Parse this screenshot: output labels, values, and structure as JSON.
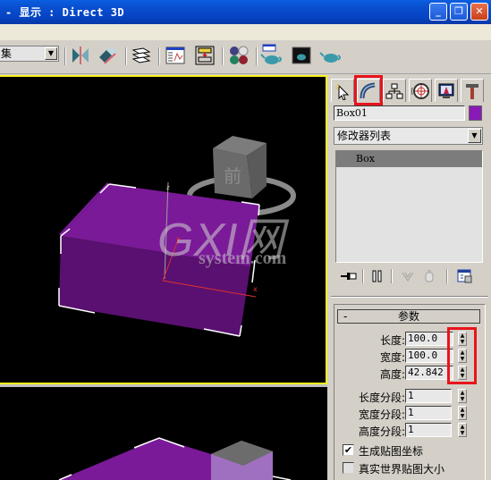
{
  "window": {
    "title": "- 显示 : Direct 3D",
    "controls": {
      "minimize": "_",
      "restore": "❐",
      "close": "✕"
    }
  },
  "toolbar": {
    "selection_set_value": "集",
    "buttons": [
      {
        "name": "mirror",
        "icon": "mirror-icon"
      },
      {
        "name": "align",
        "icon": "align-icon"
      },
      {
        "name": "layer-manager",
        "icon": "layers-icon"
      },
      {
        "name": "track-view",
        "icon": "curve-editor-icon"
      },
      {
        "name": "schematic-view",
        "icon": "schematic-icon"
      },
      {
        "name": "material-editor",
        "icon": "material-spheres-icon"
      },
      {
        "name": "render-scene",
        "icon": "render-setup-teapot-icon"
      },
      {
        "name": "rendered-frame",
        "icon": "rendered-frame-icon"
      },
      {
        "name": "quick-render",
        "icon": "quick-render-teapot-icon"
      }
    ]
  },
  "viewport": {
    "active": "top",
    "object_color": "#7a1a98",
    "viewcube_label": "前",
    "axis_labels": {
      "x": "x",
      "y": "y",
      "z": "z"
    },
    "watermark": {
      "main": "GXI网",
      "sub": "system.com"
    }
  },
  "command_panel": {
    "tabs": [
      {
        "name": "create",
        "icon": "create-icon",
        "highlighted": false
      },
      {
        "name": "modify",
        "icon": "modify-icon",
        "highlighted": true
      },
      {
        "name": "hierarchy",
        "icon": "hierarchy-icon",
        "highlighted": false
      },
      {
        "name": "motion",
        "icon": "motion-icon",
        "highlighted": false
      },
      {
        "name": "display",
        "icon": "display-icon",
        "highlighted": false
      },
      {
        "name": "utilities",
        "icon": "utilities-icon",
        "highlighted": false
      }
    ],
    "object_name": "Box01",
    "object_color": "#8a1ab8",
    "modifier_list_label": "修改器列表",
    "stack_items": [
      "Box"
    ],
    "stack_tools": [
      "pin-stack-icon",
      "show-end-result-icon",
      "make-unique-icon",
      "remove-modifier-icon",
      "configure-modifier-sets-icon"
    ],
    "rollout": {
      "title": "参数",
      "collapse_symbol": "-",
      "params": [
        {
          "label": "长度:",
          "value": "100.0"
        },
        {
          "label": "宽度:",
          "value": "100.0"
        },
        {
          "label": "高度:",
          "value": "42.842"
        },
        {
          "label": "长度分段:",
          "value": "1"
        },
        {
          "label": "宽度分段:",
          "value": "1"
        },
        {
          "label": "高度分段:",
          "value": "1"
        }
      ],
      "checkboxes": [
        {
          "label": "生成贴图坐标",
          "checked": true,
          "mark": "✔"
        },
        {
          "label": "真实世界贴图大小",
          "checked": false,
          "mark": ""
        }
      ]
    },
    "highlight_color": "#e8141c"
  }
}
